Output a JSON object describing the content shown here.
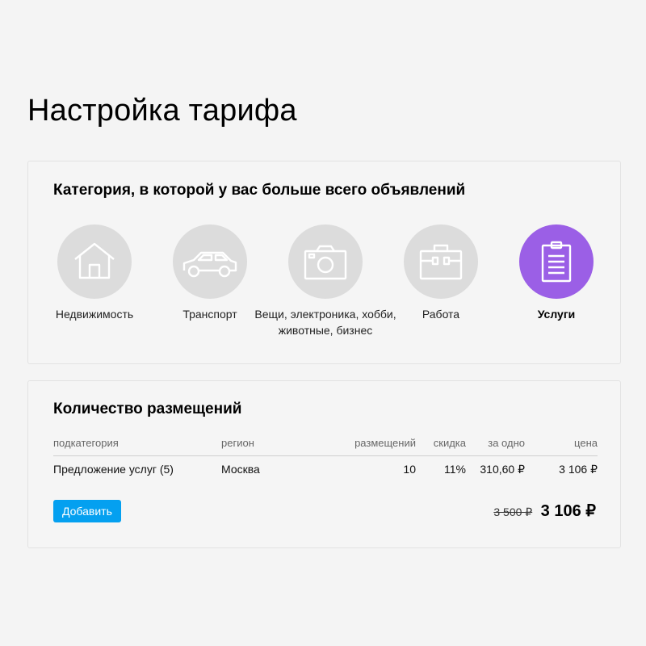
{
  "page": {
    "title": "Настройка тарифа"
  },
  "categories_card": {
    "title": "Категория, в которой у вас больше всего объявлений",
    "items": [
      {
        "label": "Недвижимость",
        "icon": "house-icon",
        "active": false
      },
      {
        "label": "Транспорт",
        "icon": "car-icon",
        "active": false
      },
      {
        "label": "Вещи, электроника, хобби, животные, бизнес",
        "icon": "camera-icon",
        "active": false
      },
      {
        "label": "Работа",
        "icon": "briefcase-icon",
        "active": false
      },
      {
        "label": "Услуги",
        "icon": "clipboard-icon",
        "active": true
      }
    ]
  },
  "placements_card": {
    "title": "Количество размещений",
    "columns": {
      "subcategory": "подкатегория",
      "region": "регион",
      "count": "размещений",
      "discount": "скидка",
      "per_one": "за одно",
      "price": "цена"
    },
    "rows": [
      {
        "subcategory": "Предложение услуг (5)",
        "region": "Москва",
        "count": "10",
        "discount": "11%",
        "per_one": "310,60 ₽",
        "price": "3 106 ₽"
      }
    ],
    "add_button": "Добавить",
    "old_total": "3 500 ₽",
    "new_total": "3 106 ₽"
  },
  "colors": {
    "accent_purple": "#9b5fe6",
    "button_blue": "#04a0f0",
    "icon_circle_gray": "#dcdcdc"
  }
}
